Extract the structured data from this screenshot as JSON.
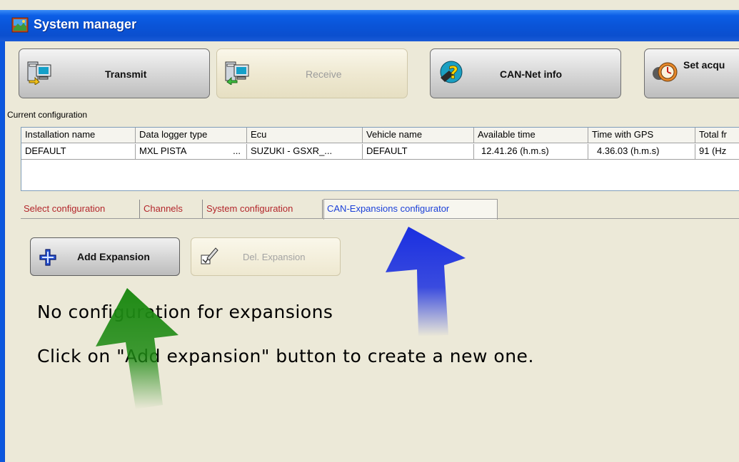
{
  "window": {
    "title": "System manager"
  },
  "toolbar": {
    "transmit": {
      "label": "Transmit"
    },
    "receive": {
      "label": "Receive"
    },
    "can_net_info": {
      "label": "CAN-Net info"
    },
    "set_acq": {
      "label": "Set acqu"
    }
  },
  "current_config": {
    "label": "Current configuration",
    "columns": [
      "Installation name",
      "Data logger type",
      "Ecu",
      "Vehicle name",
      "Available time",
      "Time with GPS",
      "Total fr"
    ],
    "row": [
      "DEFAULT",
      "MXL PISTA",
      "SUZUKI - GSXR_...",
      "DEFAULT",
      "12.41.26 (h.m.s)",
      "4.36.03 (h.m.s)",
      "91 (Hz"
    ],
    "row_ellipsis": "..."
  },
  "tabs": [
    {
      "label": "Select configuration"
    },
    {
      "label": "Channels"
    },
    {
      "label": "System configuration"
    },
    {
      "label": "CAN-Expansions configurator"
    }
  ],
  "active_tab": "CAN-Expansions configurator",
  "panel": {
    "add_expansion": "Add Expansion",
    "del_expansion": "Del. Expansion",
    "message_line1": "No configuration for expansions",
    "message_line2": "Click on \"Add expansion\" button to create a new one."
  },
  "colors": {
    "titlebar": "#0a54d8",
    "tab_inactive": "#b3262b",
    "tab_active": "#1a3fd8",
    "arrow_green": "#1e8a14",
    "arrow_blue": "#1a2fe0"
  }
}
